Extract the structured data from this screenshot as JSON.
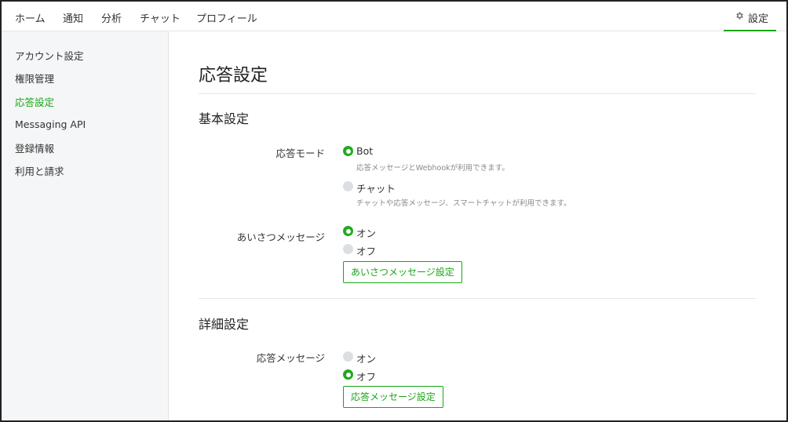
{
  "topnav": {
    "items": [
      "ホーム",
      "通知",
      "分析",
      "チャット",
      "プロフィール"
    ],
    "settings_label": "設定",
    "settings_icon": "gear-icon"
  },
  "sidebar": {
    "items": [
      {
        "label": "アカウント設定",
        "active": false
      },
      {
        "label": "権限管理",
        "active": false
      },
      {
        "label": "応答設定",
        "active": true
      },
      {
        "label": "Messaging API",
        "active": false
      },
      {
        "label": "登録情報",
        "active": false
      },
      {
        "label": "利用と請求",
        "active": false
      }
    ]
  },
  "main": {
    "title": "応答設定",
    "basic": {
      "heading": "基本設定",
      "response_mode": {
        "label": "応答モード",
        "options": [
          {
            "label": "Bot",
            "selected": true,
            "description": "応答メッセージとWebhookが利用できます。"
          },
          {
            "label": "チャット",
            "selected": false,
            "description": "チャットや応答メッセージ、スマートチャットが利用できます。"
          }
        ]
      },
      "greeting": {
        "label": "あいさつメッセージ",
        "options": [
          {
            "label": "オン",
            "selected": true
          },
          {
            "label": "オフ",
            "selected": false
          }
        ],
        "button": "あいさつメッセージ設定"
      }
    },
    "advanced": {
      "heading": "詳細設定",
      "auto_reply": {
        "label": "応答メッセージ",
        "options": [
          {
            "label": "オン",
            "selected": false
          },
          {
            "label": "オフ",
            "selected": true
          }
        ],
        "button": "応答メッセージ設定"
      }
    }
  },
  "colors": {
    "accent": "#17a617",
    "radio_off": "#dcdfe2",
    "sidebar_bg": "#f5f6f7"
  }
}
